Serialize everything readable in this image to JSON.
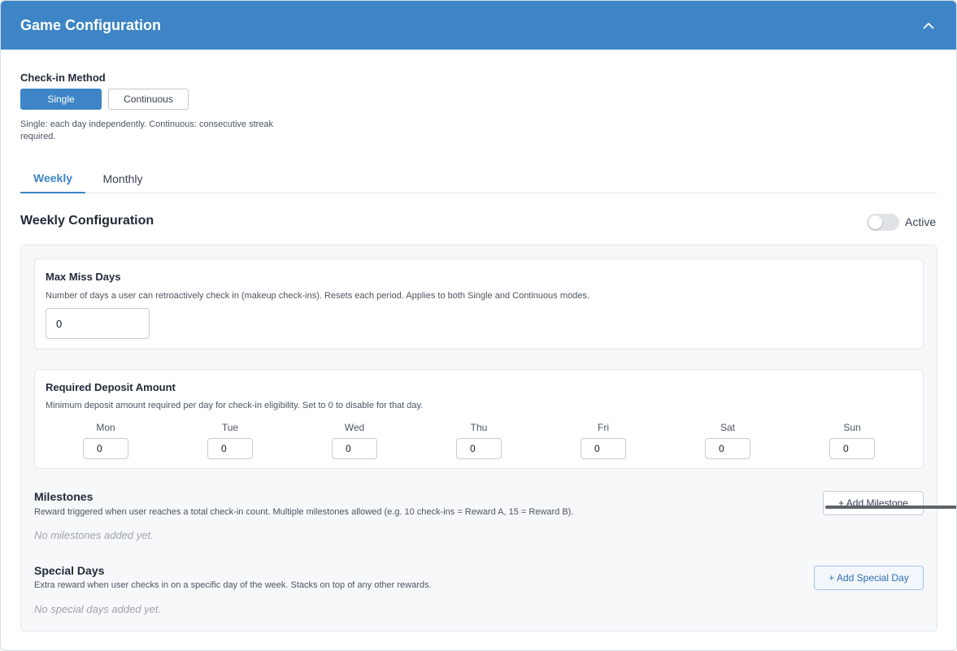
{
  "header": {
    "title": "Game Configuration",
    "collapse_icon": "chevron-up-icon"
  },
  "checkin": {
    "label": "Check-in Method",
    "options": [
      {
        "label": "Single",
        "selected": true
      },
      {
        "label": "Continuous",
        "selected": false
      }
    ],
    "help_line1": "Single: each day independently. Continuous: consecutive streak",
    "help_line2": "required."
  },
  "tabs": [
    {
      "label": "Weekly",
      "active": true
    },
    {
      "label": "Monthly",
      "active": false
    }
  ],
  "weekly": {
    "title": "Weekly Configuration",
    "toggle_label": "Active",
    "toggle_on": false,
    "max_miss": {
      "title": "Max Miss Days",
      "description": "Number of days a user can retroactively check in (makeup check-ins). Resets each period. Applies to both Single and Continuous modes.",
      "value": "0"
    },
    "deposit": {
      "title": "Required Deposit Amount",
      "description": "Minimum deposit amount required per day for check-in eligibility. Set to 0 to disable for that day.",
      "days": [
        {
          "label": "Mon",
          "value": "0"
        },
        {
          "label": "Tue",
          "value": "0"
        },
        {
          "label": "Wed",
          "value": "0"
        },
        {
          "label": "Thu",
          "value": "0"
        },
        {
          "label": "Fri",
          "value": "0"
        },
        {
          "label": "Sat",
          "value": "0"
        },
        {
          "label": "Sun",
          "value": "0"
        }
      ]
    },
    "milestones": {
      "title": "Milestones",
      "description": "Reward triggered when user reaches a total check-in count. Multiple milestones allowed (e.g. 10 check-ins = Reward A, 15 = Reward B).",
      "button_label": "+ Add Milestone",
      "empty_text": "No milestones added yet."
    },
    "special_days": {
      "title": "Special Days",
      "description": "Extra reward when user checks in on a specific day of the week. Stacks on top of any other rewards.",
      "button_label": "+ Add Special Day",
      "empty_text": "No special days added yet."
    }
  },
  "colors": {
    "accent": "#3d85c6",
    "header_bg": "#3d85c6",
    "card_bg": "#f7f8fa"
  }
}
